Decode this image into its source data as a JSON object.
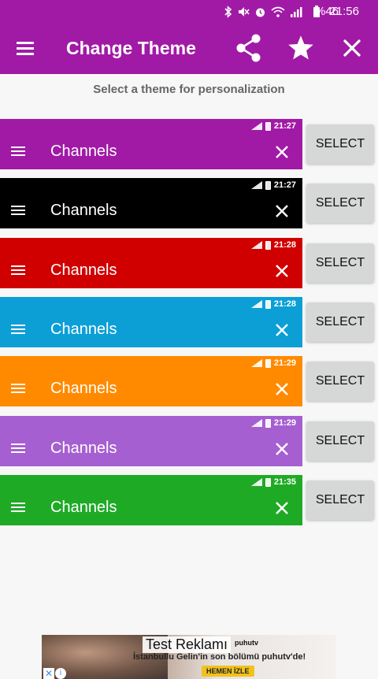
{
  "status_bar": {
    "battery_text": "%46",
    "time": "21:56",
    "icons": [
      "bluetooth-icon",
      "mute-icon",
      "alarm-icon",
      "wifi-icon",
      "signal-icon",
      "battery-icon"
    ]
  },
  "app_bar": {
    "title": "Change Theme",
    "background": "#a11aa6",
    "icons": [
      "menu-icon",
      "share-icon",
      "star-icon",
      "close-icon"
    ]
  },
  "subtitle": "Select a theme for personalization",
  "themes": [
    {
      "title": "Channels",
      "time": "21:27",
      "color": "#a11aa6",
      "button": "SELECT"
    },
    {
      "title": "Channels",
      "time": "21:27",
      "color": "#000000",
      "button": "SELECT"
    },
    {
      "title": "Channels",
      "time": "21:28",
      "color": "#d00000",
      "button": "SELECT"
    },
    {
      "title": "Channels",
      "time": "21:28",
      "color": "#0b9fd6",
      "button": "SELECT"
    },
    {
      "title": "Channels",
      "time": "21:29",
      "color": "#ff8a00",
      "button": "SELECT"
    },
    {
      "title": "Channels",
      "time": "21:29",
      "color": "#a65fd0",
      "button": "SELECT"
    },
    {
      "title": "Channels",
      "time": "21:35",
      "color": "#1faa26",
      "button": "SELECT"
    }
  ],
  "ad": {
    "label": "Test Reklamı",
    "brand": "puhutv",
    "text": "İstanbullu Gelin'in son bölümü puhutv'de!",
    "cta": "HEMEN İZLE"
  }
}
